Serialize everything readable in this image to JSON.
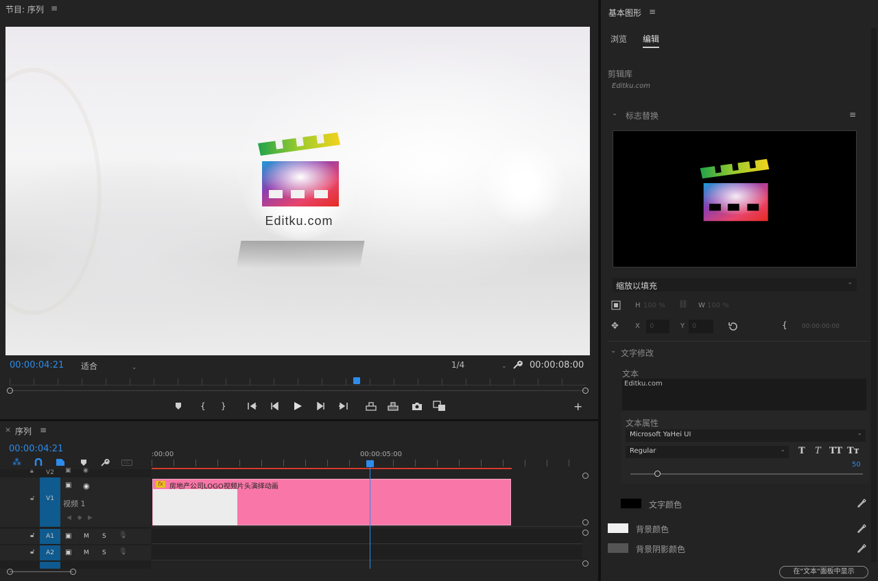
{
  "program": {
    "title": "节目: 序列",
    "menu_glyph": "≡",
    "timecode_current": "00:00:04:21",
    "zoom_label": "适合",
    "resolution_label": "1/4",
    "timecode_duration": "00:00:08:00",
    "frame_text": "Editku.com"
  },
  "timeline": {
    "close_glyph": "×",
    "title": "序列",
    "menu_glyph": "≡",
    "timecode": "00:00:04:21",
    "ruler_start": ":00:00",
    "ruler_mid": "00:00:05:00",
    "tracks": {
      "v2": "V2",
      "v1": "V1",
      "v1_name": "视频 1",
      "a1": "A1",
      "a2": "A2",
      "m": "M",
      "s": "S"
    },
    "clip_label": "房地产公司LOGO视频片头演绎动画",
    "clip_fx": "fx"
  },
  "essential": {
    "title": "基本图形",
    "menu_glyph": "≡",
    "tabs": {
      "browse": "浏览",
      "edit": "编辑"
    },
    "library_label": "剪辑库",
    "library_value": "Editku.com",
    "section_logo": "标志替换",
    "fit_option": "缩放以填充",
    "h_label": "H",
    "h_value": "100 %",
    "w_label": "W",
    "w_value": "100 %",
    "x_label": "X",
    "x_value": "0",
    "y_label": "Y",
    "y_value": "0",
    "rot_timecode": "00:00:00:00",
    "section_text": "文字修改",
    "text_label": "文本",
    "text_value": "Editku.com",
    "text_props": "文本属性",
    "font_family": "Microsoft YaHei UI",
    "font_style": "Regular",
    "font_size": "50",
    "text_color_label": "文字颜色",
    "bg_color_label": "背景颜色",
    "bg_shadow_label": "背景阴影颜色",
    "show_in_text_panel": "在\"文本\"面板中显示",
    "colors": {
      "text_color": "#000000",
      "bg_color": "#f0f0f0",
      "bg_shadow": "#555555"
    }
  }
}
